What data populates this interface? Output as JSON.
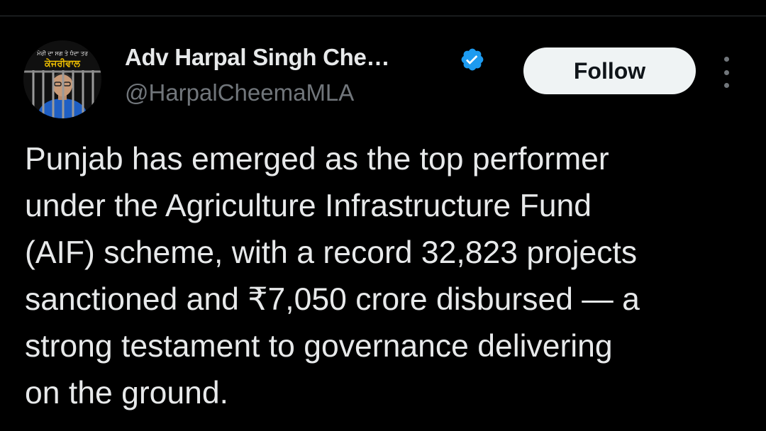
{
  "author": {
    "display_name": "Adv Harpal Singh Che…",
    "handle": "@HarpalCheemaMLA",
    "verified": true,
    "verified_icon": "verified-badge-icon",
    "avatar": {
      "top_text": "ਮੇਰੀ ਦਾ ਸਗ ਤੇ ਧੰਦਾ ਤਰ",
      "main_text": "ਕੇਜਰੀਵਾਲ"
    }
  },
  "actions": {
    "follow_label": "Follow",
    "more_icon": "more-vertical-icon"
  },
  "tweet": {
    "text": "Punjab has emerged as the top performer\nunder the Agriculture Infrastructure Fund\n(AIF) scheme, with a record 32,823 projects\nsanctioned and ₹7,050 crore disbursed — a\nstrong testament to governance delivering\non the ground."
  },
  "colors": {
    "background": "#000000",
    "text_primary": "#e7e9ea",
    "text_secondary": "#71767b",
    "verified_blue": "#1d9bf0",
    "follow_bg": "#eff3f4",
    "follow_text": "#0f1419",
    "divider": "#2f3336"
  }
}
